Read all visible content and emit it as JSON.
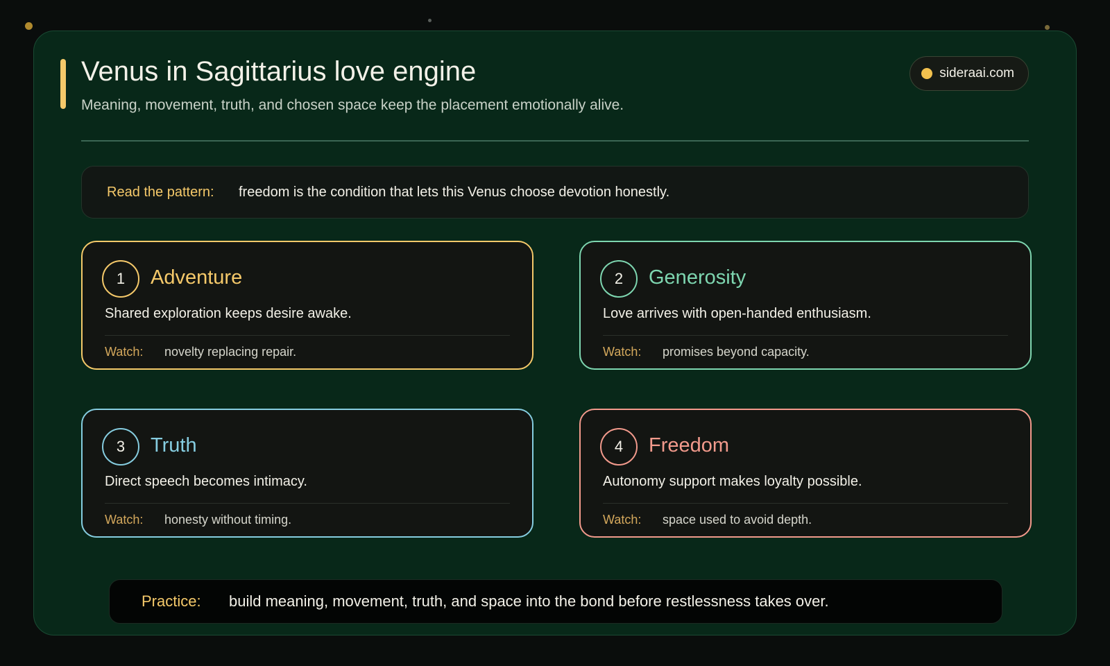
{
  "colors": {
    "background": "#0a0d0c",
    "panel": "#082819",
    "gold": "#f2c14e",
    "label_gold": "#f5c96a",
    "green": "#7ed6b0",
    "cyan": "#86cde0",
    "coral": "#f29a8c"
  },
  "header": {
    "title": "Venus in Sagittarius love engine",
    "subtitle": "Meaning, movement, truth, and chosen space keep the placement emotionally alive.",
    "site": "sideraai.com",
    "site_dot_icon": "dot-icon"
  },
  "pattern": {
    "label": "Read the pattern:",
    "text": "freedom is the condition that lets this Venus choose devotion honestly."
  },
  "cards": [
    {
      "number": "1",
      "title": "Adventure",
      "description": "Shared exploration keeps desire awake.",
      "watch_label": "Watch:",
      "watch_text": "novelty replacing repair.",
      "color": "#f5c96a"
    },
    {
      "number": "2",
      "title": "Generosity",
      "description": "Love arrives with open-handed enthusiasm.",
      "watch_label": "Watch:",
      "watch_text": "promises beyond capacity.",
      "color": "#7ed6b0"
    },
    {
      "number": "3",
      "title": "Truth",
      "description": "Direct speech becomes intimacy.",
      "watch_label": "Watch:",
      "watch_text": "honesty without timing.",
      "color": "#86cde0"
    },
    {
      "number": "4",
      "title": "Freedom",
      "description": "Autonomy support makes loyalty possible.",
      "watch_label": "Watch:",
      "watch_text": "space used to avoid depth.",
      "color": "#f29a8c"
    }
  ],
  "practice": {
    "label": "Practice:",
    "text": "build meaning, movement, truth, and space into the bond before restlessness takes over."
  }
}
